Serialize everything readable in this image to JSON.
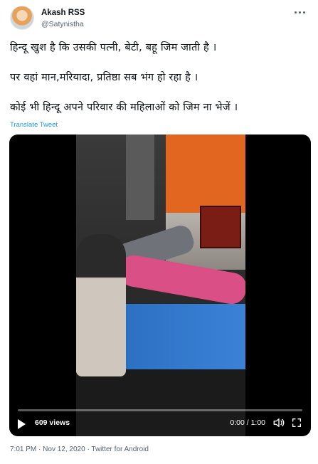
{
  "author": {
    "name": "Akash RSS",
    "handle": "@Satynistha"
  },
  "tweet": {
    "lines": [
      "हिन्दू खुश है कि उसकी पत्नी, बेटी, बहू  जिम जाती है  ।",
      "पर वहां मान,मरियादा, प्रतिष्ठा  सब भंग हो रहा है ।",
      "कोई भी हिन्दू अपने परिवार की महिलाओं को   जिम   ना भेजें  ।"
    ],
    "translate_label": "Translate Tweet"
  },
  "video": {
    "views": "609 views",
    "time": "0:00 / 1:00",
    "progress": 0
  },
  "meta": {
    "time": "7:01 PM",
    "separator": "·",
    "date": "Nov 12, 2020",
    "client": "Twitter for Android"
  },
  "icons": {
    "play": "play-icon",
    "volume": "volume-icon",
    "fullscreen": "fullscreen-icon",
    "more": "more-icon"
  },
  "colors": {
    "link": "#1d9bf0",
    "secondary_text": "#536471"
  }
}
